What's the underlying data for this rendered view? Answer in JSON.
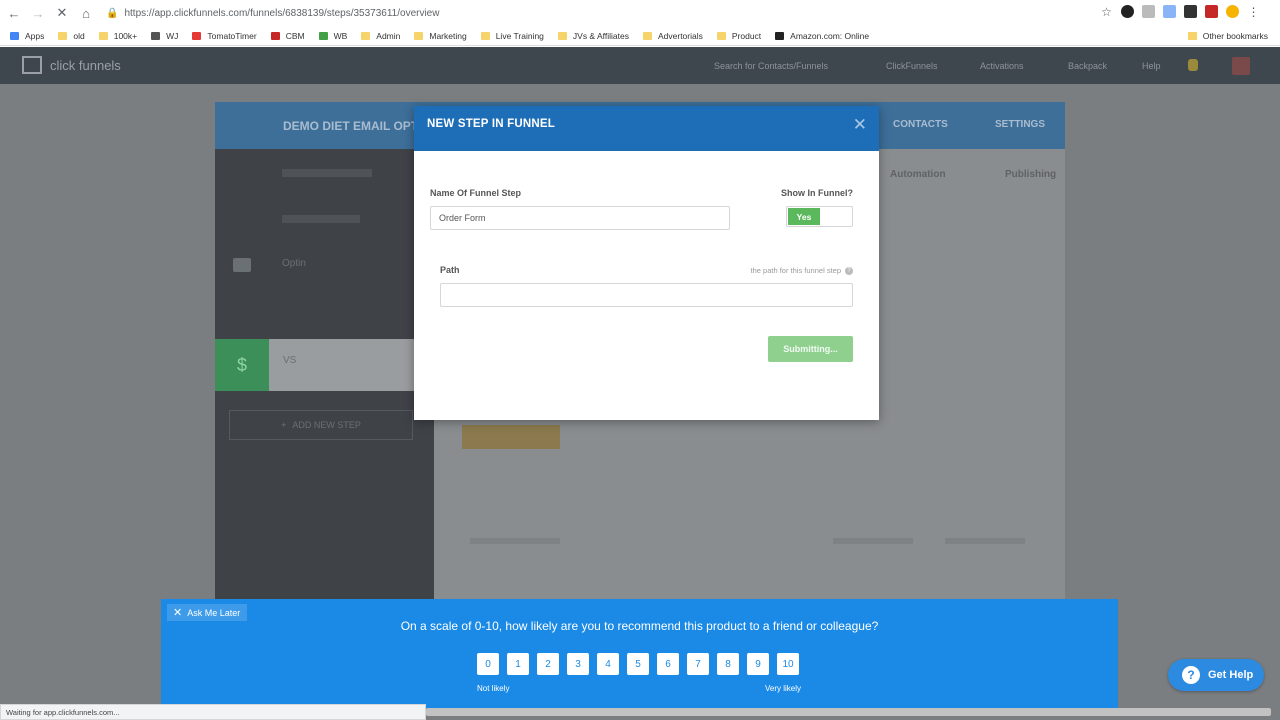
{
  "browser": {
    "url": "https://app.clickfunnels.com/funnels/6838139/steps/35373611/overview",
    "status_text": "Waiting for app.clickfunnels.com...",
    "bookmarks": [
      {
        "label": "Apps",
        "icon": "apps-grid-icon",
        "color": "#4285f4"
      },
      {
        "label": "old",
        "icon": "folder-icon",
        "color": "#f6d36b"
      },
      {
        "label": "100k+",
        "icon": "folder-icon",
        "color": "#f6d36b"
      },
      {
        "label": "WJ",
        "icon": "bookmark-icon",
        "color": "#555555"
      },
      {
        "label": "TomatoTimer",
        "icon": "tomato-icon",
        "color": "#e53935"
      },
      {
        "label": "CBM",
        "icon": "cbm-icon",
        "color": "#c62828"
      },
      {
        "label": "WB",
        "icon": "wb-icon",
        "color": "#43a047"
      },
      {
        "label": "Admin",
        "icon": "folder-icon",
        "color": "#f6d36b"
      },
      {
        "label": "Marketing",
        "icon": "folder-icon",
        "color": "#f6d36b"
      },
      {
        "label": "Live Training",
        "icon": "folder-icon",
        "color": "#f6d36b"
      },
      {
        "label": "JVs & Affiliates",
        "icon": "folder-icon",
        "color": "#f6d36b"
      },
      {
        "label": "Advertorials",
        "icon": "folder-icon",
        "color": "#f6d36b"
      },
      {
        "label": "Product",
        "icon": "folder-icon",
        "color": "#f6d36b"
      },
      {
        "label": "Amazon.com: Online",
        "icon": "amazon-icon",
        "color": "#222222"
      }
    ],
    "other_bookmarks": "Other bookmarks"
  },
  "app": {
    "logo": "click funnels",
    "search_placeholder": "Search for Contacts/Funnels",
    "nav": [
      "ClickFunnels",
      "Activations",
      "Backpack",
      "Help"
    ],
    "funnel_title": "DEMO DIET EMAIL OPT",
    "panel_links": [
      "CONTACTS",
      "SETTINGS"
    ],
    "sidebar": [
      "Optin",
      "VS"
    ],
    "add_step": "ADD NEW STEP",
    "tabs": [
      "Automation",
      "Publishing"
    ]
  },
  "modal": {
    "title": "NEW STEP IN FUNNEL",
    "name_label": "Name Of Funnel Step",
    "name_value": "Order Form",
    "show_label": "Show In Funnel?",
    "toggle_value": "Yes",
    "path_label": "Path",
    "path_hint": "the path for this funnel step",
    "path_value": "",
    "submit_label": "Submitting..."
  },
  "nps": {
    "ask_later": "Ask Me Later",
    "question": "On a scale of 0-10, how likely are you to recommend this product to a friend or colleague?",
    "scale": [
      "0",
      "1",
      "2",
      "3",
      "4",
      "5",
      "6",
      "7",
      "8",
      "9",
      "10"
    ],
    "low_label": "Not likely",
    "high_label": "Very likely"
  },
  "help": {
    "label": "Get Help"
  },
  "colors": {
    "modal_header": "#1d6db7",
    "toggle_on": "#5cb85c",
    "nps_background": "#1a8ae6"
  }
}
